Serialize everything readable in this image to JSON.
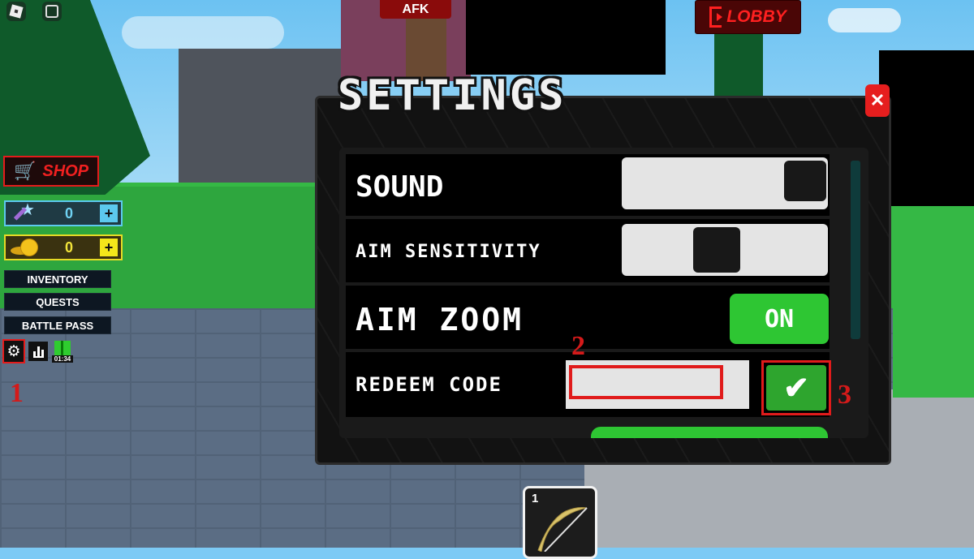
{
  "hud": {
    "top_icons": [
      "roblox-menu-icon",
      "chat-icon"
    ],
    "afk_label": "AFK",
    "lobby_label": "LOBBY",
    "shop_label": "SHOP",
    "currencies": [
      {
        "name": "keys",
        "value": "0",
        "plus": "+",
        "color": "#5cc9ee"
      },
      {
        "name": "coins",
        "value": "0",
        "plus": "+",
        "color": "#f4e61a"
      }
    ],
    "menu": [
      "INVENTORY",
      "QUESTS",
      "BATTLE PASS"
    ],
    "gift_timer": "01:34"
  },
  "settings": {
    "title": "SETTINGS",
    "close_label": "✕",
    "rows": [
      {
        "label": "SOUND",
        "type": "slider",
        "value": 1.0
      },
      {
        "label": "AIM SENSITIVITY",
        "type": "slider",
        "value": 0.45
      },
      {
        "label": "AIM ZOOM",
        "type": "toggle",
        "value": "ON"
      },
      {
        "label": "REDEEM CODE",
        "type": "input",
        "value": "",
        "submit": "✔"
      }
    ]
  },
  "annotations": [
    "1",
    "2",
    "3"
  ],
  "hotbar": {
    "slots": [
      {
        "number": "1",
        "item": "bow"
      }
    ]
  },
  "colors": {
    "accent_red": "#e41b1b",
    "toggle_green": "#2ec633"
  }
}
